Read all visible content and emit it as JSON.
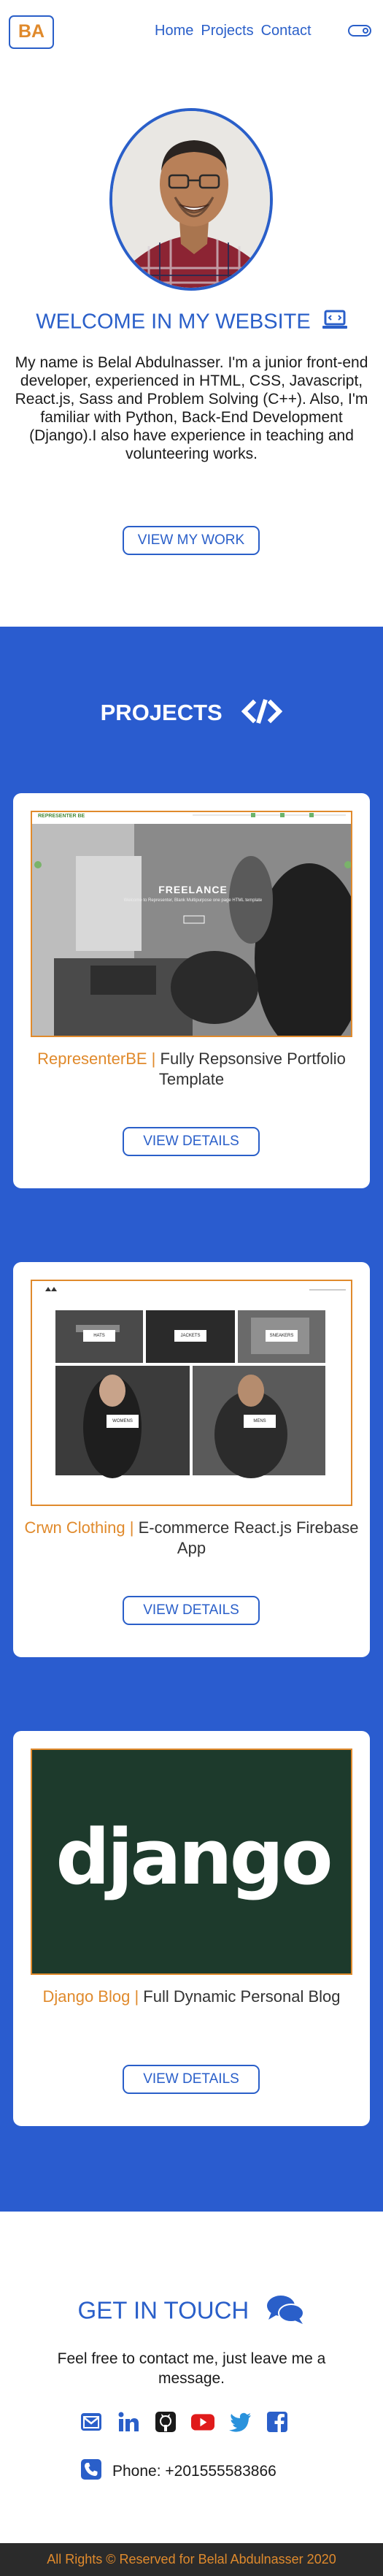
{
  "nav": {
    "logo": "BA",
    "links": [
      "Home",
      "Projects",
      "Contact"
    ],
    "theme_toggle_icon": "toggle-icon"
  },
  "hero": {
    "title": "WELCOME IN MY WEBSITE",
    "title_icon": "laptop-icon",
    "text": "My name is Belal Abdulnasser. I'm a junior front-end developer, experienced in HTML, CSS, Javascript, React.js, Sass and Problem Solving (C++). Also, I'm familiar with Python, Back-End Development (Django).I also have experience in teaching and volunteering works.",
    "button": "VIEW MY WORK"
  },
  "projects": {
    "title": "PROJECTS",
    "title_icon": "code-icon",
    "items": [
      {
        "name": "RepresenterBE",
        "separator": " | ",
        "description": "Fully Repsonsive Portfolio Template",
        "button": "VIEW DETAILS",
        "shot_brand": "REPRESENTER BE",
        "shot_heading": "FREELANCE",
        "shot_sub": "Welcome to Representer, Blank Multipurpose one page HTML template"
      },
      {
        "name": "Crwn Clothing",
        "separator": " | ",
        "description": "E-commerce React.js Firebase App",
        "button": "VIEW DETAILS",
        "shot_tiles": [
          "HATS",
          "JACKETS",
          "SNEAKERS",
          "WOMENS",
          "MENS"
        ]
      },
      {
        "name": "Django Blog",
        "separator": " | ",
        "description": "Full Dynamic Personal Blog",
        "button": "VIEW DETAILS",
        "shot_logo": "django"
      }
    ]
  },
  "contact": {
    "title": "GET IN TOUCH",
    "title_icon": "chat-icon",
    "text": "Feel free to contact me, just leave me a message.",
    "socials": [
      "email-icon",
      "linkedin-icon",
      "github-icon",
      "youtube-icon",
      "twitter-icon",
      "facebook-icon"
    ],
    "phone": "Phone: +201555583866"
  },
  "footer": {
    "text": "All Rights © Reserved for Belal Abdulnasser 2020"
  },
  "colors": {
    "primary": "#2a5fc9",
    "accent": "#e08a2c",
    "projects_bg": "#2a5ccf",
    "footer_bg": "#2b2b2b"
  }
}
